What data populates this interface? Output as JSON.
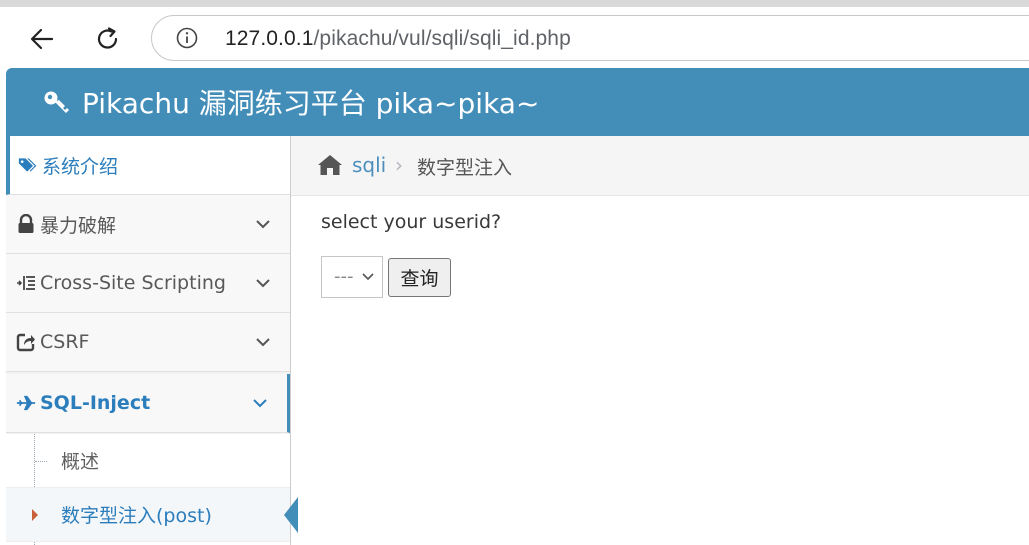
{
  "browser": {
    "url_host": "127.0.0.1",
    "url_path": "/pikachu/vul/sqli/sqli_id.php"
  },
  "navbar": {
    "brand": "Pikachu 漏洞练习平台 pika~pika~",
    "brand_icon": "key-icon",
    "color": "#438eb9"
  },
  "sidebar": {
    "items": [
      {
        "label": "系统介绍",
        "icon": "tags-icon"
      },
      {
        "label": "暴力破解",
        "icon": "lock-icon"
      },
      {
        "label": "Cross-Site Scripting",
        "icon": "list-indent-icon"
      },
      {
        "label": "CSRF",
        "icon": "share-square-icon"
      },
      {
        "label": "SQL-Inject",
        "icon": "plane-icon"
      }
    ],
    "submenu": [
      {
        "label": "概述"
      },
      {
        "label": "数字型注入(post)"
      }
    ]
  },
  "breadcrumb": {
    "link": "sqli",
    "separator": "›",
    "current": "数字型注入"
  },
  "form": {
    "prompt": "select your userid?",
    "select_value": "---",
    "button": "查询"
  }
}
